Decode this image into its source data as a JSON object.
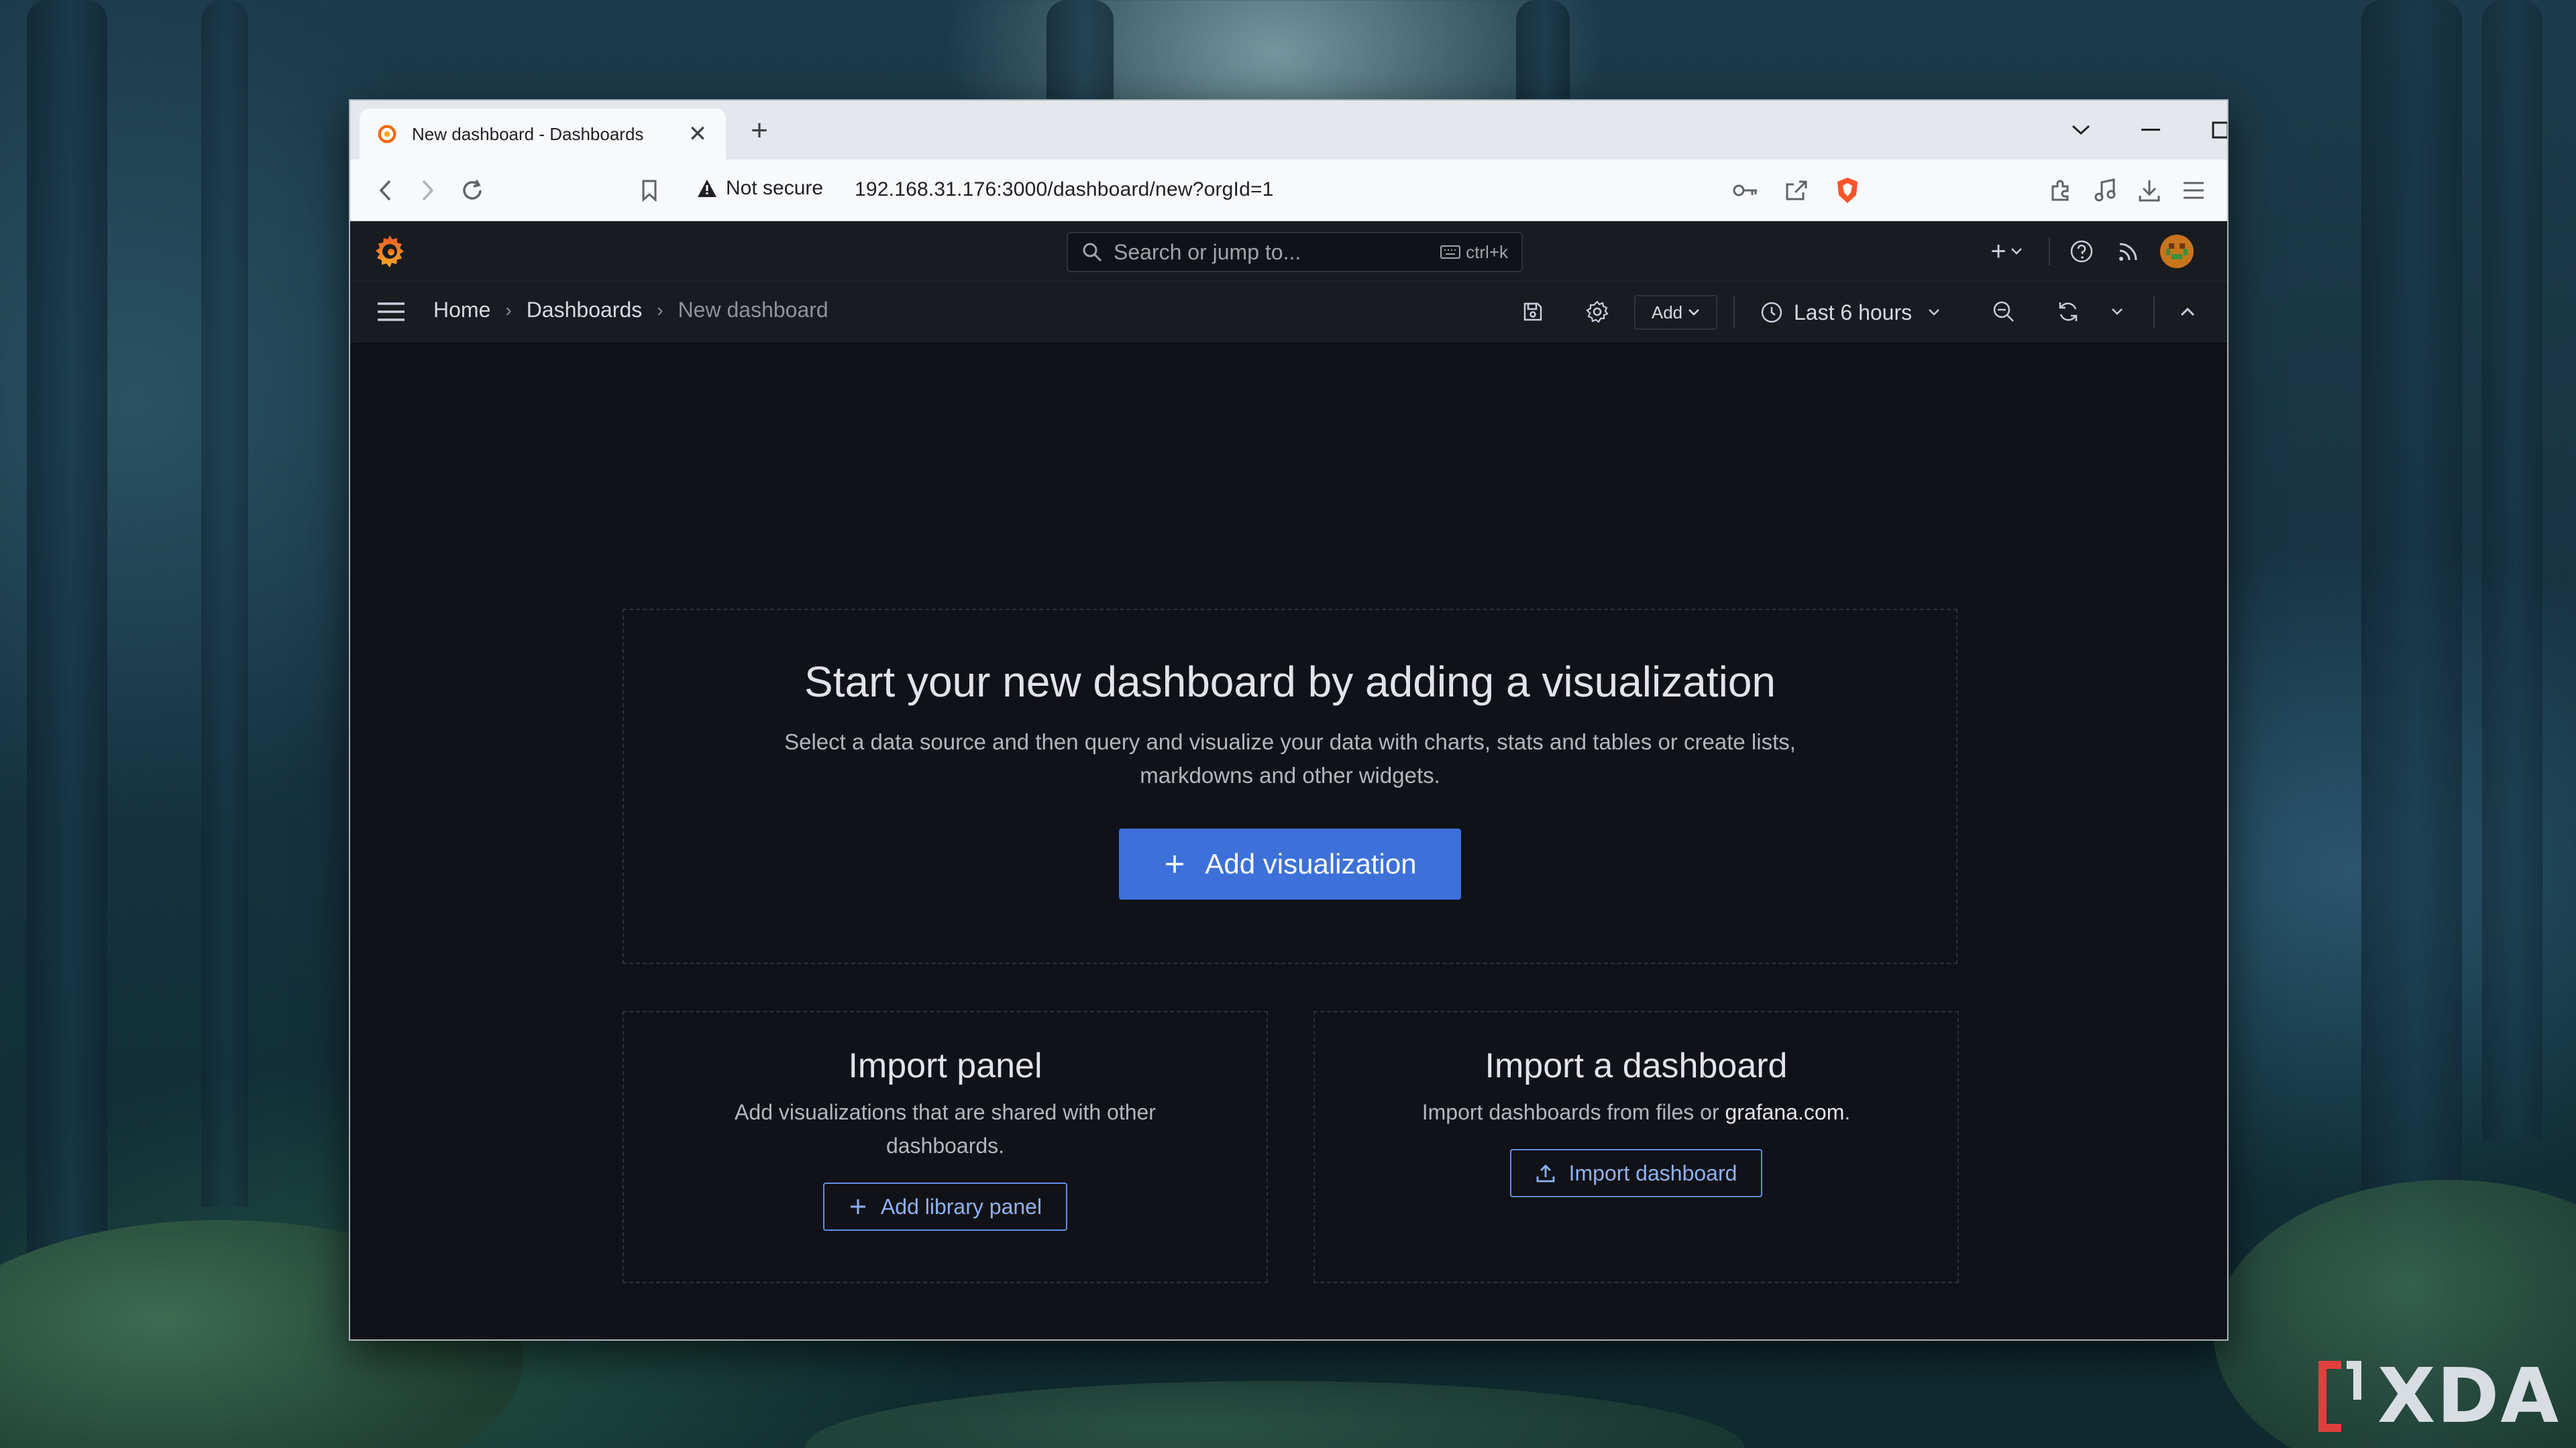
{
  "browser": {
    "tab_title": "New dashboard - Dashboards",
    "security_label": "Not secure",
    "url": "192.168.31.176:3000/dashboard/new?orgId=1"
  },
  "grafana": {
    "search": {
      "placeholder": "Search or jump to...",
      "shortcut": "ctrl+k"
    },
    "breadcrumb": [
      "Home",
      "Dashboards",
      "New dashboard"
    ],
    "add_label": "Add",
    "time_range": "Last 6 hours",
    "hero": {
      "title": "Start your new dashboard by adding a visualization",
      "description_line1": "Select a data source and then query and visualize your data with charts, stats and tables or create lists,",
      "description_line2": "markdowns and other widgets.",
      "button": "Add visualization"
    },
    "import_panel": {
      "title": "Import panel",
      "description": "Add visualizations that are shared with other dashboards.",
      "button": "Add library panel"
    },
    "import_dashboard": {
      "title": "Import a dashboard",
      "description_prefix": "Import dashboards from files or ",
      "link": "grafana.com",
      "description_suffix": ".",
      "button": "Import dashboard"
    }
  },
  "watermark": "XDA",
  "colors": {
    "primary": "#3d71d9",
    "grafana_orange": "#f46800",
    "background": "#111217"
  }
}
